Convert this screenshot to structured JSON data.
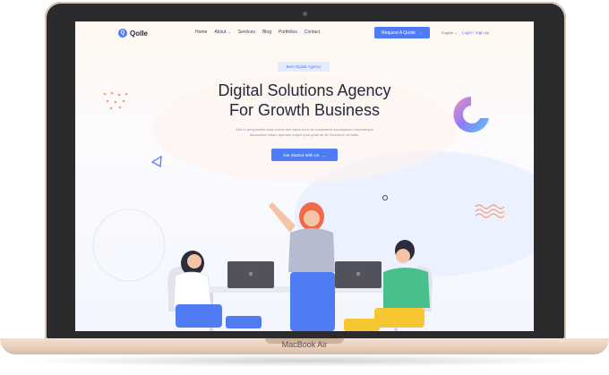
{
  "device": {
    "label": "MacBook Air"
  },
  "site": {
    "logo_text": "Qolle",
    "logo_mark": "Q",
    "nav": {
      "links": [
        "Home",
        "About",
        "Services",
        "Blog",
        "Portfolios",
        "Contact"
      ],
      "about_chevron": "chevron-down-icon"
    },
    "cta_button": {
      "label": "Request A Quote",
      "arrow": "→"
    },
    "language": "English ⌄",
    "auth": "Login / Sign up"
  },
  "hero": {
    "badge": "Best Digital Agency",
    "headline_line1": "Digital Solutions Agency",
    "headline_line2": "For Growth Business",
    "subtext_line1": "Sed ut perspiciatis unde omnis iste natus error sit voluptatem accusantium doloremque",
    "subtext_line2": "laudantium totam aperiam eaque ipsa quae ab illo inventore veritatis.",
    "button_label": "Get Started With Us",
    "button_arrow": "→"
  },
  "colors": {
    "primary": "#4e7cf6",
    "headline": "#23283c",
    "accent_orange": "#f6a074",
    "accent_purple": "#8a7ef4",
    "accent_pink": "#f58bc2"
  }
}
